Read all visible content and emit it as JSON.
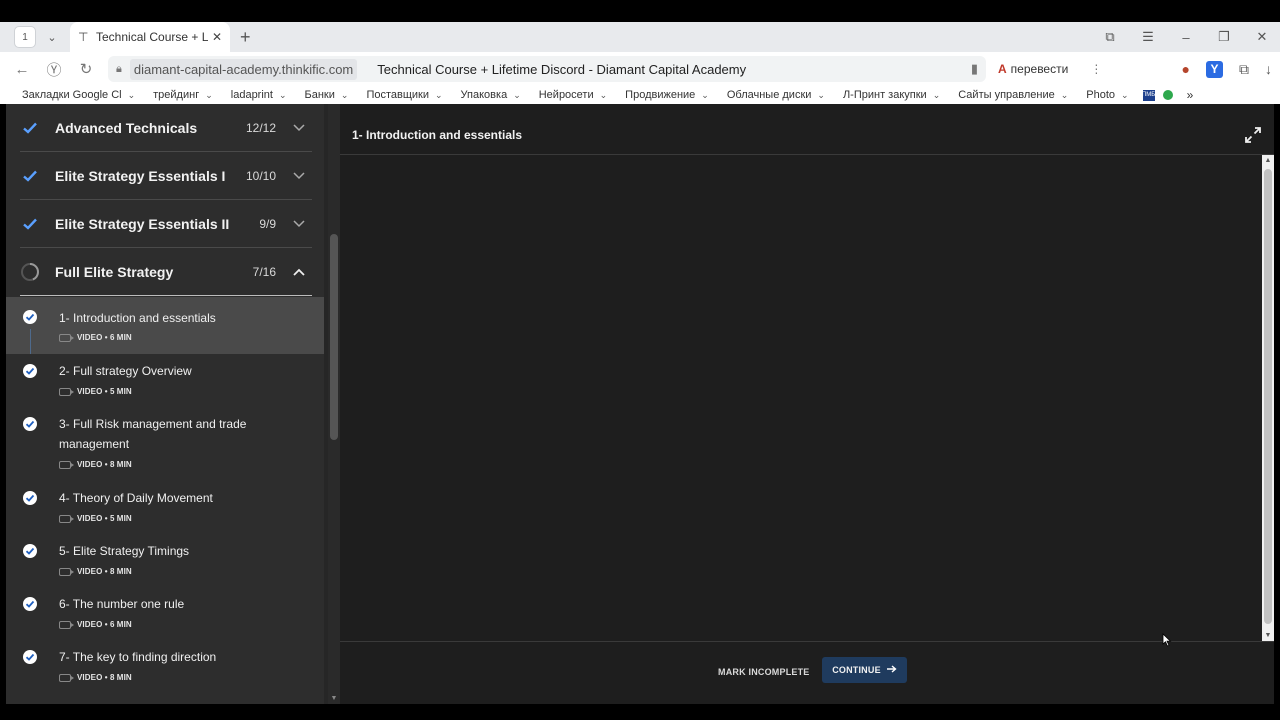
{
  "browser": {
    "tab_count": "1",
    "tab_title": "Technical Course + Lifetime",
    "address_domain": "diamant-capital-academy.thinkific.com",
    "page_title": "Technical Course + Lifetime Discord - Diamant Capital Academy",
    "translate_label": "перевести",
    "bookmarks": [
      "Закладки Google Cl",
      "трейдинг",
      "ladaprint",
      "Банки",
      "Поставщики",
      "Упаковка",
      "Нейросети",
      "Продвижение",
      "Облачные диски",
      "Л-Принт закупки",
      "Сайты управление",
      "Photo"
    ],
    "bookmark_badge": "ПМБ"
  },
  "sidebar": {
    "chapters": [
      {
        "title": "Advanced Technicals",
        "count": "12/12",
        "status": "complete"
      },
      {
        "title": "Elite Strategy Essentials I",
        "count": "10/10",
        "status": "complete"
      },
      {
        "title": "Elite Strategy Essentials II",
        "count": "9/9",
        "status": "complete"
      },
      {
        "title": "Full Elite Strategy",
        "count": "7/16",
        "status": "in-progress",
        "progress": 0.4375
      }
    ],
    "lessons": [
      {
        "title": "1- Introduction and essentials",
        "meta": "VIDEO • 6 MIN"
      },
      {
        "title": "2- Full strategy Overview",
        "meta": "VIDEO • 5 MIN"
      },
      {
        "title": "3- Full Risk management and trade management",
        "meta": "VIDEO • 8 MIN"
      },
      {
        "title": "4- Theory of Daily Movement",
        "meta": "VIDEO • 5 MIN"
      },
      {
        "title": "5- Elite Strategy Timings",
        "meta": "VIDEO • 8 MIN"
      },
      {
        "title": "6- The number one rule",
        "meta": "VIDEO • 6 MIN"
      },
      {
        "title": "7- The key to finding direction",
        "meta": "VIDEO • 8 MIN"
      }
    ]
  },
  "content": {
    "title": "1- Introduction and essentials",
    "mark_incomplete": "MARK INCOMPLETE",
    "continue": "CONTINUE"
  },
  "colors": {
    "accent": "#1f3b5e",
    "check_badge": "#ffffff",
    "check_mark": "#1f5fbf"
  }
}
